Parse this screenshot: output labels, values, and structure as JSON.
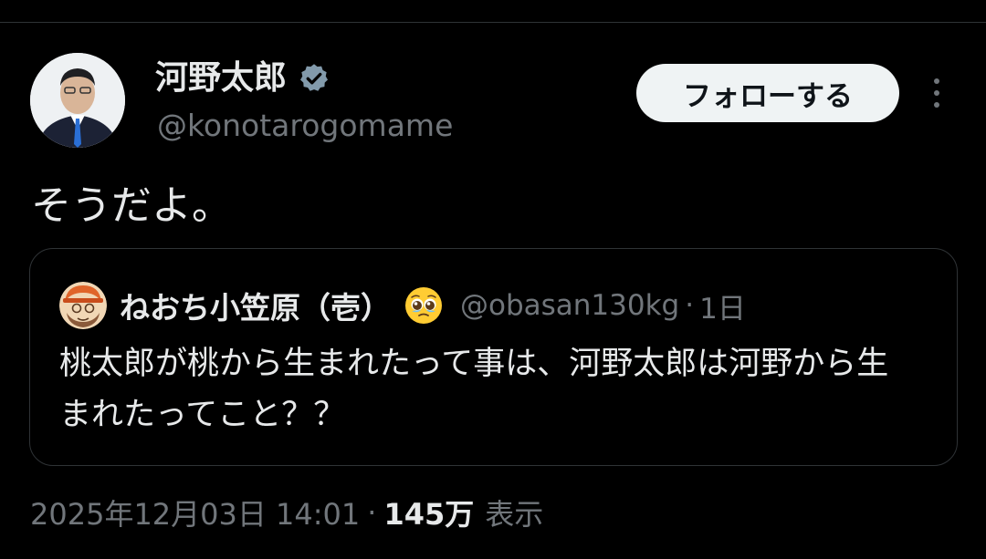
{
  "tweet": {
    "author": {
      "display_name": "河野太郎",
      "handle": "@konotarogomame",
      "verified": true,
      "avatar_icon": "user-avatar"
    },
    "follow_label": "フォローする",
    "more_icon": "more-vertical-icon",
    "text": "そうだよ。",
    "quote": {
      "display_name": "ねおち小笠原（壱）",
      "emoji_icon": "pleading-face-emoji",
      "handle": "@obasan130kg",
      "separator": "·",
      "time": "1日",
      "text": "桃太郎が桃から生まれたって事は、河野太郎は河野から生まれたってこと？？"
    },
    "meta": {
      "datetime": "2025年12月03日 14:01",
      "separator": "·",
      "views_count": "145万",
      "views_label": "表示"
    }
  },
  "colors": {
    "background": "#000000",
    "primary_text": "#e7e9ea",
    "secondary_text": "#71767b",
    "border": "#2f3336",
    "follow_button_bg": "#eff3f4",
    "verified_badge": "#829aab"
  }
}
